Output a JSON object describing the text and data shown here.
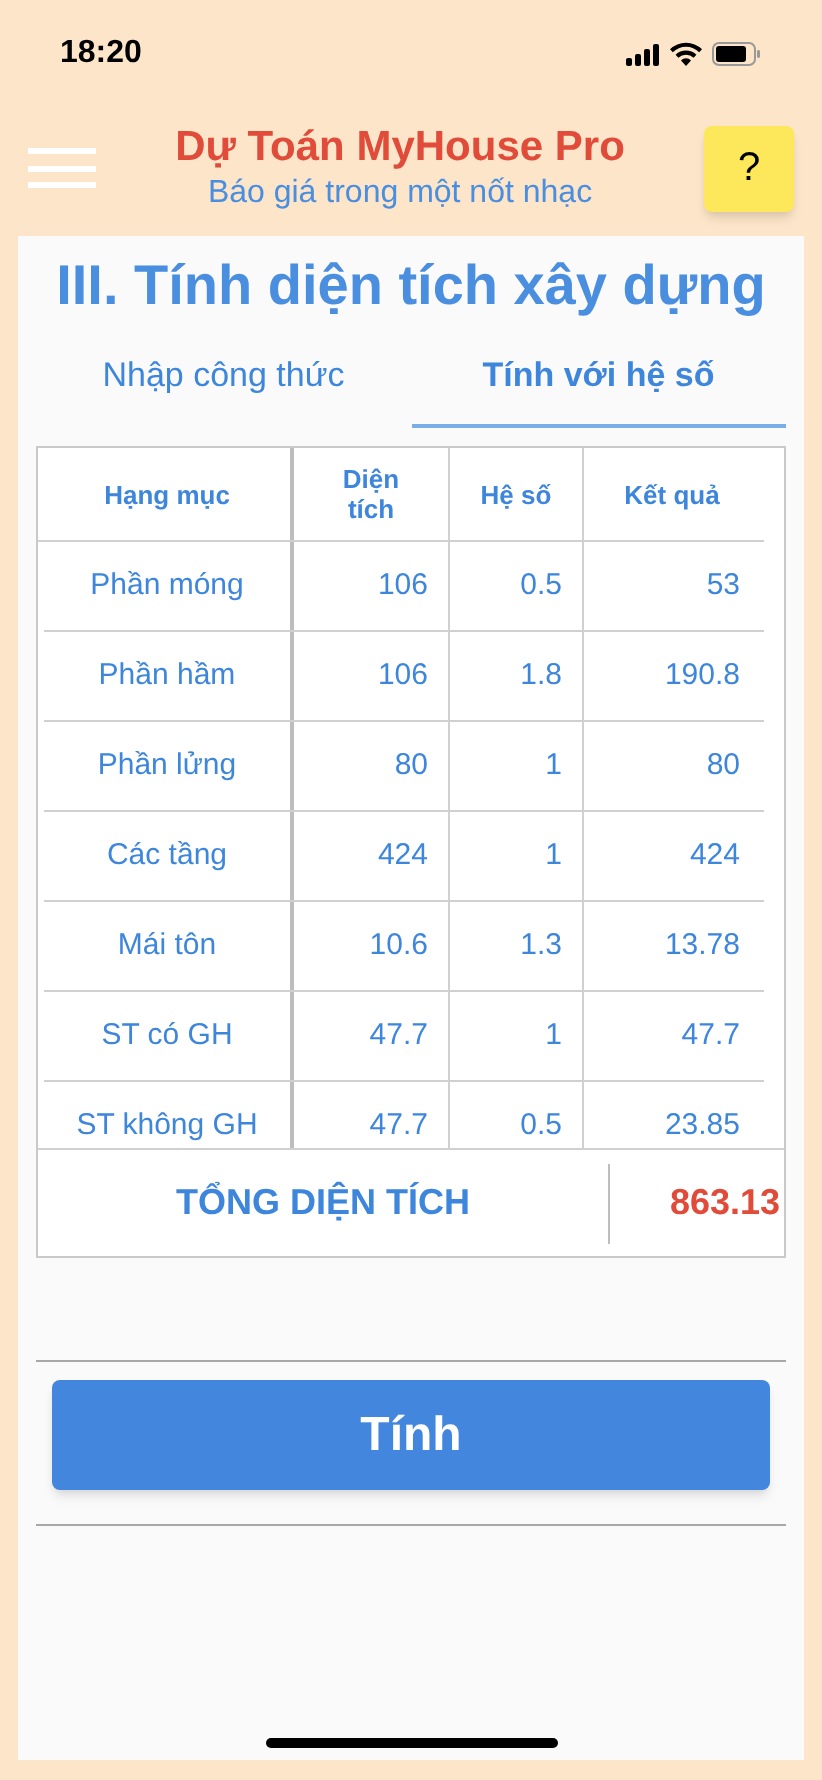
{
  "status_bar": {
    "time": "18:20"
  },
  "header": {
    "title": "Dự Toán MyHouse Pro",
    "subtitle": "Báo giá trong một nốt nhạc",
    "help_button": "?"
  },
  "section_title": "III. Tính diện tích xây dựng",
  "tabs": [
    {
      "label": "Nhập công thức",
      "selected": false
    },
    {
      "label": "Tính với hệ số",
      "selected": true
    }
  ],
  "table": {
    "columns": [
      "Hạng mục",
      "Diện tích",
      "Hệ số",
      "Kết quả"
    ],
    "rows": [
      [
        "Phần móng",
        "106",
        "0.5",
        "53"
      ],
      [
        "Phần hầm",
        "106",
        "1.8",
        "190.8"
      ],
      [
        "Phần lửng",
        "80",
        "1",
        "80"
      ],
      [
        "Các tầng",
        "424",
        "1",
        "424"
      ],
      [
        "Mái tôn",
        "10.6",
        "1.3",
        "13.78"
      ],
      [
        "ST có GH",
        "47.7",
        "1",
        "47.7"
      ],
      [
        "ST không GH",
        "47.7",
        "0.5",
        "23.85"
      ]
    ],
    "total_label": "TỔNG DIỆN TÍCH",
    "total_value": "863.13"
  },
  "calculate_button": "Tính"
}
